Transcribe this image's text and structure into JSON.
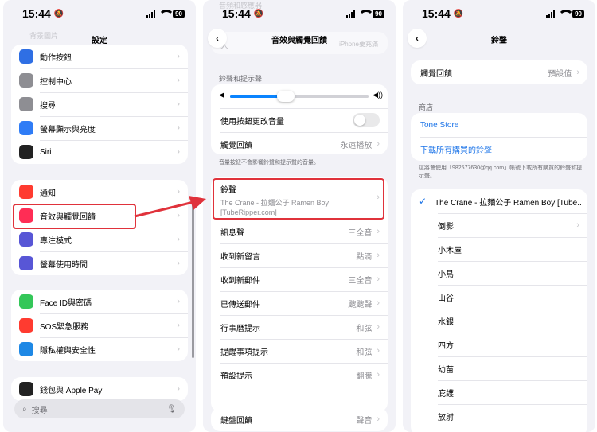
{
  "status": {
    "time": "15:44",
    "battery": "90"
  },
  "panel1": {
    "title": "設定",
    "faded_top": "背景圖片",
    "group1": [
      {
        "label": "動作按鈕",
        "icon": "action-icon",
        "color": "#2f6fe4"
      },
      {
        "label": "控制中心",
        "icon": "control-center-icon",
        "color": "#8e8e93"
      },
      {
        "label": "搜尋",
        "icon": "search-icon",
        "color": "#8e8e93"
      },
      {
        "label": "螢幕顯示與亮度",
        "icon": "brightness-icon",
        "color": "#2f7cf6"
      },
      {
        "label": "Siri",
        "icon": "siri-icon",
        "color": "#222222"
      }
    ],
    "group2": [
      {
        "label": "通知",
        "icon": "bell-icon",
        "color": "#ff3b30"
      },
      {
        "label": "音效與觸覺回饋",
        "icon": "speaker-icon",
        "color": "#ff2d55"
      },
      {
        "label": "專注模式",
        "icon": "moon-icon",
        "color": "#5856d6"
      },
      {
        "label": "螢幕使用時間",
        "icon": "hourglass-icon",
        "color": "#5856d6"
      }
    ],
    "group3": [
      {
        "label": "Face ID與密碼",
        "icon": "faceid-icon",
        "color": "#34c759"
      },
      {
        "label": "SOS緊急服務",
        "icon": "sos-icon",
        "color": "#ff3b30"
      },
      {
        "label": "隱私權與安全性",
        "icon": "hand-icon",
        "color": "#1e88e5"
      }
    ],
    "group4": [
      {
        "label": "錢包與 Apple Pay",
        "icon": "wallet-icon",
        "color": "#222222"
      }
    ],
    "search_placeholder": "搜尋"
  },
  "panel2": {
    "title": "音效與觸覺回饋",
    "faded_top_left": "人",
    "faded_top_right": "iPhone要充滿",
    "faded_very_top": "音頻和感應器",
    "section_title": "鈴聲和提示聲",
    "volume_fraction": 0.4,
    "toggle_label": "使用按鈕更改音量",
    "haptics_label": "觸覺回饋",
    "haptics_value": "永遠播放",
    "note": "音量按鈕不會影響鈴聲和提示聲的音量。",
    "ringtone_label": "鈴聲",
    "ringtone_value": "The Crane - 拉麵公子 Ramen Boy [TubeRipper.com]",
    "rows": [
      {
        "label": "訊息聲",
        "value": "三全音"
      },
      {
        "label": "收到新留言",
        "value": "點滴"
      },
      {
        "label": "收到新郵件",
        "value": "三全音"
      },
      {
        "label": "已傳送郵件",
        "value": "颼颼聲"
      },
      {
        "label": "行事曆提示",
        "value": "和弦"
      },
      {
        "label": "提醒事項提示",
        "value": "和弦"
      },
      {
        "label": "預設提示",
        "value": "翻騰"
      }
    ],
    "bottom_label": "鍵盤回饋",
    "bottom_value": "聲音"
  },
  "panel3": {
    "title": "鈴聲",
    "haptics_label": "觸覺回饋",
    "haptics_value": "預設值",
    "store_section": "商店",
    "tone_store": "Tone Store",
    "download_all": "下載所有購買的鈴聲",
    "note": "這將會使用「982577630@qq.com」帳號下載所有購買的鈴聲和提示聲。",
    "selected": "The Crane - 拉麵公子 Ramen Boy [Tube...",
    "tones": [
      "倒影",
      "小木屋",
      "小鳥",
      "山谷",
      "水銀",
      "四方",
      "幼苗",
      "庇護",
      "放射"
    ]
  }
}
